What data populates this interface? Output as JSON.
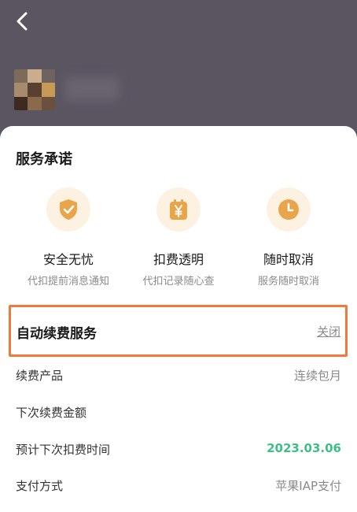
{
  "header": {
    "back_icon": "chevron-left-icon"
  },
  "promise_section": {
    "title": "服务承诺",
    "items": [
      {
        "icon": "shield-check-icon",
        "title": "安全无忧",
        "subtitle": "代扣提前消息通知"
      },
      {
        "icon": "yen-calendar-icon",
        "title": "扣费透明",
        "subtitle": "代扣记录随心查"
      },
      {
        "icon": "clock-icon",
        "title": "随时取消",
        "subtitle": "服务随时取消"
      }
    ]
  },
  "auto_renew": {
    "title": "自动续费服务",
    "action": "关闭",
    "highlight_color": "#f07a3c"
  },
  "details": [
    {
      "label": "续费产品",
      "value": "连续包月"
    },
    {
      "label": "下次续费金额",
      "value": ""
    },
    {
      "label": "预计下次扣费时间",
      "value": "2023.03.06"
    },
    {
      "label": "支付方式",
      "value": "苹果IAP支付"
    }
  ],
  "colors": {
    "header_bg": "#5b5562",
    "accent_green": "#3dbf86",
    "icon_gold": "#e9a54a",
    "badge_bg": "#fdf1e2"
  }
}
